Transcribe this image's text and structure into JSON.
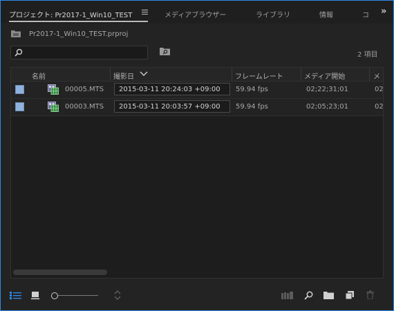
{
  "tabs": {
    "project": "プロジェクト: Pr2017-1_Win10_TEST",
    "media_browser": "メディアブラウザー",
    "libraries": "ライブラリ",
    "info": "情報",
    "clipped": "コ"
  },
  "project_path": "Pr2017-1_Win10_TEST.prproj",
  "search": {
    "value": "",
    "placeholder": ""
  },
  "item_count": "2 項目",
  "columns": {
    "name": "名前",
    "date_shot": "撮影日",
    "frame_rate": "フレームレート",
    "media_start": "メディア開始",
    "more": "メ"
  },
  "rows": [
    {
      "name": "00005.MTS",
      "date_shot": "2015-03-11 20:24:03 +09:00",
      "frame_rate": "59.94 fps",
      "media_start": "02;22;31;01",
      "more": "02",
      "color": "#8fb1dc"
    },
    {
      "name": "00003.MTS",
      "date_shot": "2015-03-11 20:03:57 +09:00",
      "frame_rate": "59.94 fps",
      "media_start": "02;05;23;01",
      "more": "02",
      "color": "#8fb1dc"
    }
  ],
  "icons": {
    "tab_menu": "hamburger-icon",
    "overflow": "double-chevron-right-icon",
    "project_folder": "folder-icon",
    "search": "search-icon",
    "new_bin_from_search": "bin-search-icon",
    "sort": "chevron-down-icon",
    "clip": "sequence-clip-icon",
    "list_view": "list-view-icon",
    "icon_view": "icon-view-icon",
    "zoom_slider": "zoom-slider",
    "sort_icons": "sort-icons-icon",
    "automate": "automate-to-sequence-icon",
    "find": "find-icon",
    "new_bin": "new-bin-icon",
    "new_item": "new-item-icon",
    "clear": "trash-icon"
  },
  "colors": {
    "accent": "#2d8ceb",
    "label_iris": "#8fb1dc",
    "clip_icon": "#5aa55a"
  }
}
